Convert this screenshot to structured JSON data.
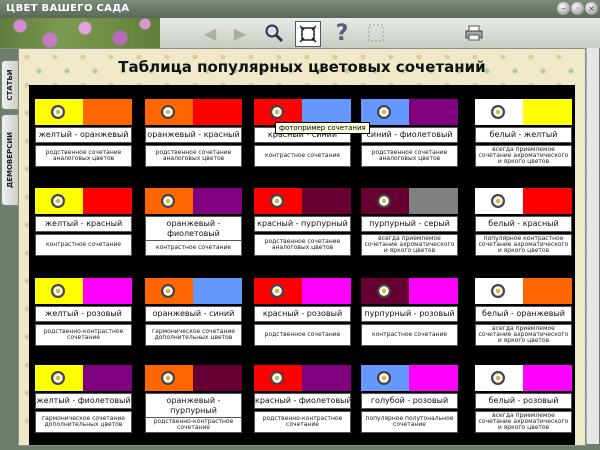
{
  "window": {
    "title": "ЦВЕТ ВАШЕГО САДА"
  },
  "sidebar": {
    "tabs": [
      "СТАТЬИ",
      "ДЕМОВЕРСИИ"
    ]
  },
  "page": {
    "title": "Таблица популярных цветовых сочетаний"
  },
  "tooltip": "фотопример сочетания",
  "cards": [
    {
      "name": "желтый - оранжевый",
      "desc": "родственное сочетание аналоговых цветов",
      "colors": [
        "#ffff00",
        "#ff6600"
      ]
    },
    {
      "name": "оранжевый - красный",
      "desc": "родственное сочетание аналоговых цветов",
      "colors": [
        "#ff6600",
        "#ff0000"
      ]
    },
    {
      "name": "красный - синий",
      "desc": "контрастное сочетание",
      "colors": [
        "#ff0000",
        "#6699ff"
      ]
    },
    {
      "name": "синий - фиолетовый",
      "desc": "родственное сочетание аналоговых цветов",
      "colors": [
        "#6699ff",
        "#800080"
      ]
    },
    {
      "name": "белый - желтый",
      "desc": "всегда приемлемое сочетание ахроматического и яркого цветов",
      "colors": [
        "#ffffff",
        "#ffff00"
      ]
    },
    {
      "name": "желтый - красный",
      "desc": "контрастное сочетание",
      "colors": [
        "#ffff00",
        "#ff0000"
      ]
    },
    {
      "name": "оранжевый - фиолетовый",
      "desc": "контрастное сочетание",
      "colors": [
        "#ff6600",
        "#800080"
      ]
    },
    {
      "name": "красный - пурпурный",
      "desc": "родственное сочетание аналоговых цветов",
      "colors": [
        "#ff0000",
        "#660033"
      ]
    },
    {
      "name": "пурпурный - серый",
      "desc": "всегда приемлемое сочетание ахроматического и яркого цветов",
      "colors": [
        "#660033",
        "#808080"
      ]
    },
    {
      "name": "белый - красный",
      "desc": "популярное контрастное сочетание ахроматического и яркого цветов",
      "colors": [
        "#ffffff",
        "#ff0000"
      ]
    },
    {
      "name": "желтый - розовый",
      "desc": "родственно-контрастное сочетание",
      "colors": [
        "#ffff00",
        "#ff00ff"
      ]
    },
    {
      "name": "оранжевый - синий",
      "desc": "гармоническое сочетание дополнительных цветов",
      "colors": [
        "#ff6600",
        "#6699ff"
      ]
    },
    {
      "name": "красный - розовый",
      "desc": "родственное сочетание",
      "colors": [
        "#ff0000",
        "#ff00ff"
      ]
    },
    {
      "name": "пурпурный - розовый",
      "desc": "контрастное сочетание",
      "colors": [
        "#660033",
        "#ff00ff"
      ]
    },
    {
      "name": "белый - оранжевый",
      "desc": "всегда приемлемое сочетание ахроматического и яркого цветов",
      "colors": [
        "#ffffff",
        "#ff6600"
      ]
    },
    {
      "name": "желтый - фиолетовый",
      "desc": "гармоническое сочетание дополнительных цветов",
      "colors": [
        "#ffff00",
        "#800080"
      ]
    },
    {
      "name": "оранжевый - пурпурный",
      "desc": "родственно-контрастное сочетание",
      "colors": [
        "#ff6600",
        "#660033"
      ]
    },
    {
      "name": "красный - фиолетовый",
      "desc": "родственно-контрастное сочетание",
      "colors": [
        "#ff0000",
        "#800080"
      ]
    },
    {
      "name": "голубой - розовый",
      "desc": "популярное полутональное сочетание",
      "colors": [
        "#6699ff",
        "#ff00ff"
      ]
    },
    {
      "name": "белый - розовый",
      "desc": "всегда приемлемое сочетание ахроматического и яркого цветов",
      "colors": [
        "#ffffff",
        "#ff00ff"
      ]
    }
  ]
}
